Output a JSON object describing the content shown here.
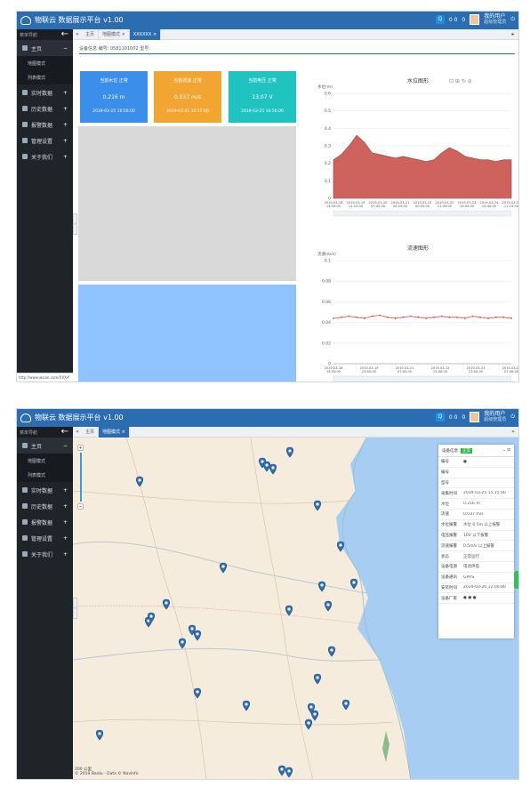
{
  "app": {
    "title": "物联云 数据展示平台 v1.00",
    "url": "http://www.wsian.com/XXX#"
  },
  "topbar": {
    "search": "Q",
    "icon_a": "0 0",
    "icon_b": "0",
    "user_name": "我的用户",
    "user_role": "超级管理员",
    "logout": "⏻"
  },
  "sidebar": {
    "header": "菜单导航",
    "items": [
      {
        "label": "主页",
        "icon": "home-icon"
      },
      {
        "label": "地图模式"
      },
      {
        "label": "列表模式"
      },
      {
        "label": "实时数据",
        "icon": "cloud-icon"
      },
      {
        "label": "历史数据",
        "icon": "bar-chart-icon"
      },
      {
        "label": "报警数据",
        "icon": "table-icon"
      },
      {
        "label": "管理设置",
        "icon": "gear-icon"
      },
      {
        "label": "关于我们",
        "icon": "info-icon"
      }
    ]
  },
  "tabs1": [
    {
      "label": "主页"
    },
    {
      "label": "地图模式 ×"
    },
    {
      "label": "XXXXXX ×"
    }
  ],
  "tabs2": [
    {
      "label": "主页"
    },
    {
      "label": "地图模式 ×"
    }
  ],
  "device": {
    "crumb": "设备信息   编号: 0581101002   型号: "
  },
  "cards": [
    {
      "title": "当前水位 正常",
      "value": "0.216 m",
      "date": "2019-03-25 16:56:00",
      "color": "#3b8ee9"
    },
    {
      "title": "当前流速 正常",
      "value": "0.037 m/s",
      "date": "2019-03-25 16:15:00",
      "color": "#f3a531"
    },
    {
      "title": "当前电压 正常",
      "value": "13.07 V",
      "date": "2019-03-25 16:56:00",
      "color": "#1fc3c0"
    }
  ],
  "charts_text": {
    "left_ticks": [
      "0.5",
      "0.4",
      "0.3",
      "0.2",
      "0.1",
      "0"
    ],
    "top_toolbar": "⊡ ⊞ ↻ ⊘"
  },
  "chart_data": [
    {
      "type": "area",
      "title": "水位图形",
      "ylabel": "水位(m)",
      "ylim": [
        0,
        0.6
      ],
      "x": [
        "2019-03-18 14:59:00",
        "2019-03-19 11:10:00",
        "2019-03-20 07:45:00",
        "2019-03-21 04:20:00",
        "2019-03-22 00:55:00",
        "2019-03-22 21:30:00",
        "2019-03-23 18:05:00",
        "2019-03-24 14:40:00",
        "2019-03-25 11:15:00"
      ],
      "yticks": [
        "0.6",
        "0.5",
        "0.4",
        "0.3",
        "0.2",
        "0.1",
        "0"
      ],
      "series": [
        {
          "values": [
            0.22,
            0.25,
            0.3,
            0.36,
            0.32,
            0.26,
            0.25,
            0.24,
            0.23,
            0.24,
            0.23,
            0.22,
            0.21,
            0.22,
            0.26,
            0.29,
            0.27,
            0.24,
            0.23,
            0.22,
            0.22,
            0.21,
            0.22,
            0.22
          ]
        }
      ],
      "color": "#c9524c"
    },
    {
      "type": "line",
      "title": "流速图形",
      "ylabel": "流速(m/s)",
      "ylim": [
        0,
        0.1
      ],
      "x": [
        "2019-03-18 14:59:00",
        "2019-03-19 23:00:00",
        "2019-03-21 07:00:00",
        "2019-03-22 15:00:00",
        "2019-03-23 23:00:00",
        "2019-03-25 07:00:00"
      ],
      "yticks": [
        "0.1",
        "0.08",
        "0.06",
        "0.04",
        "0.02",
        "0"
      ],
      "series": [
        {
          "values": [
            0.044,
            0.045,
            0.046,
            0.045,
            0.044,
            0.046,
            0.047,
            0.045,
            0.044,
            0.045,
            0.046,
            0.045,
            0.044,
            0.045,
            0.046,
            0.045,
            0.045,
            0.044,
            0.046,
            0.045,
            0.044,
            0.045,
            0.045,
            0.044
          ]
        }
      ],
      "color": "#c9524c"
    }
  ],
  "map": {
    "scale_label": "200 公里",
    "attribution": "© 2019 Baidu - Data © NavInfo",
    "info": {
      "title": "设备信息",
      "status": "正常",
      "rows": [
        {
          "k": "编号",
          "v": "●"
        },
        {
          "k": "编号",
          "v": ""
        },
        {
          "k": "型号",
          "v": ""
        },
        {
          "k": "采集时间",
          "v": "2019-03-25 15:15:00"
        },
        {
          "k": "水位",
          "v": "0.216 m"
        },
        {
          "k": "流速",
          "v": "0.037 m/s"
        },
        {
          "k": "水位报警",
          "v": "水位 0.5m 以上报警"
        },
        {
          "k": "电压报警",
          "v": "10V 以下报警"
        },
        {
          "k": "流速报警",
          "v": "0.5m/s 以上报警"
        },
        {
          "k": "状态",
          "v": "正常运行"
        },
        {
          "k": "设备电源",
          "v": "电池供电"
        },
        {
          "k": "设备通讯",
          "v": "GPRS"
        },
        {
          "k": "安装时间",
          "v": "2019-03-20 12:00:00"
        },
        {
          "k": "设备厂家",
          "v": "●  ●  ●"
        }
      ]
    }
  },
  "colors": {
    "primary": "#2b6db0",
    "sidebar": "#1f2429",
    "water_land": "#f5ecdd",
    "sea": "#a7cdf2"
  }
}
